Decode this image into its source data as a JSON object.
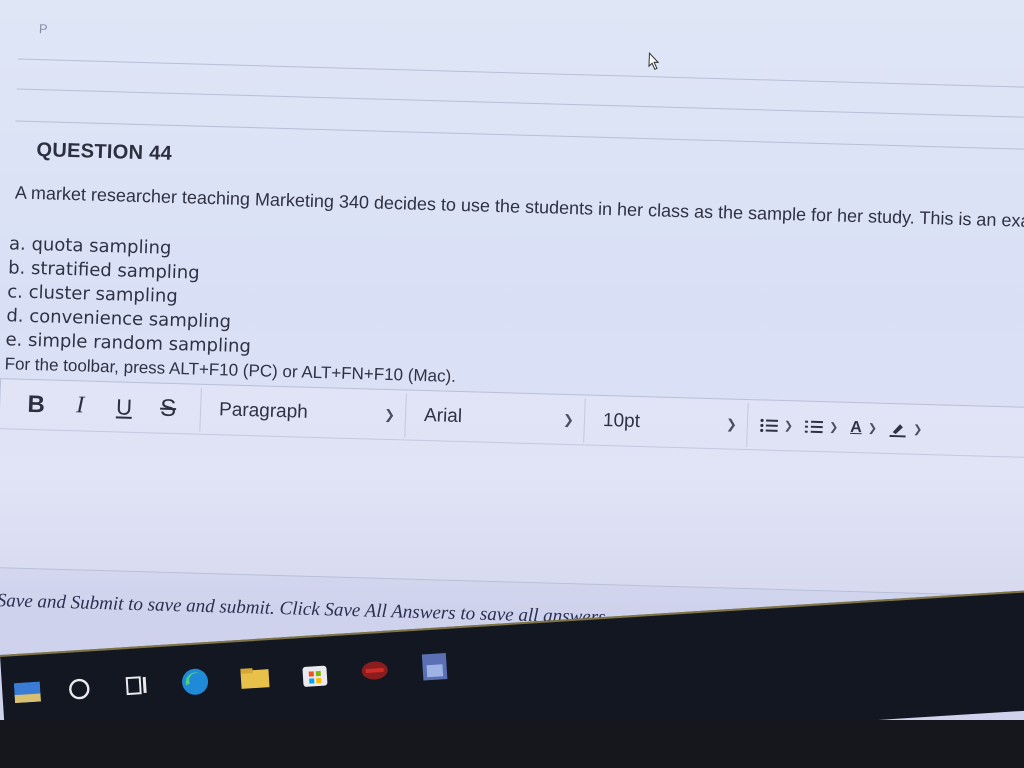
{
  "previous_item_letter": "P",
  "question": {
    "title": "QUESTION 44",
    "text": "A market researcher teaching Marketing 340 decides to use the students in her class as the sample for her study. This is an examp"
  },
  "options": [
    "a. quota sampling",
    "b. stratified sampling",
    "c. cluster sampling",
    "d. convenience sampling",
    "e. simple random sampling"
  ],
  "toolbar_hint": "For the toolbar, press ALT+F10 (PC) or ALT+FN+F10 (Mac).",
  "toolbar": {
    "bold": "B",
    "italic": "I",
    "underline": "U",
    "strikethrough": "S",
    "paragraph_select": "Paragraph",
    "font_select": "Arial",
    "size_select": "10pt",
    "font_color_label": "A"
  },
  "icons": {
    "chevron": "chevron-down-icon",
    "bullet_list": "bullet-list-icon",
    "numbered_list": "numbered-list-icon",
    "font_color": "font-color-icon",
    "highlight": "highlight-pen-icon"
  },
  "footer_note": "ick Save and Submit to save and submit. Click Save All Answers to save all answers.",
  "taskbar": {
    "items": [
      "start-icon",
      "search-icon",
      "task-view-icon",
      "edge-icon",
      "file-explorer-icon",
      "store-icon",
      "app-icon",
      "app2-icon"
    ]
  },
  "colors": {
    "screen_bg": "#dfe6f6",
    "text": "#2e3142",
    "taskbar": "#131722"
  }
}
